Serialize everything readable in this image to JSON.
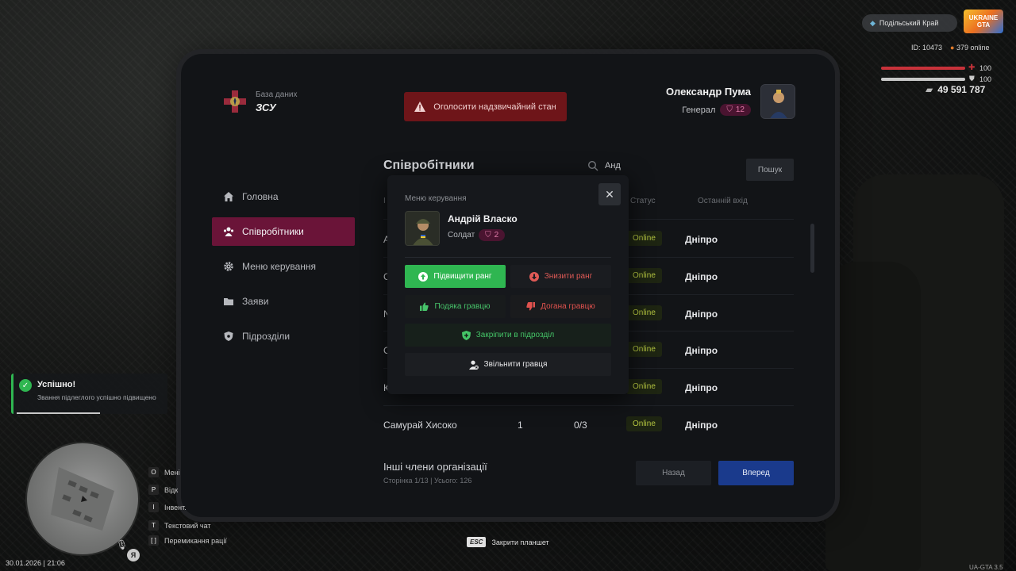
{
  "brand": {
    "subtitle": "База даних",
    "title": "ЗСУ"
  },
  "alert_button": {
    "label": "Оголосити надзвичайний стан"
  },
  "user": {
    "name": "Олександр Пума",
    "rank": "Генерал",
    "rank_level": "12"
  },
  "sidebar": {
    "items": [
      {
        "label": "Головна",
        "icon": "home-icon",
        "active": false
      },
      {
        "label": "Співробітники",
        "icon": "people-icon",
        "active": true
      },
      {
        "label": "Меню керування",
        "icon": "gear-icon",
        "active": false
      },
      {
        "label": "Заяви",
        "icon": "folder-icon",
        "active": false
      },
      {
        "label": "Підрозділи",
        "icon": "shield-icon",
        "active": false
      }
    ]
  },
  "main": {
    "title": "Співробітники",
    "search_value": "Анд",
    "search_button": "Пошук",
    "columns": {
      "id": "І",
      "status": "Статус",
      "last_login": "Останній вхід"
    },
    "rows": [
      {
        "name_initial": "А",
        "status": "Online",
        "city": "Дніпро"
      },
      {
        "name_initial": "С",
        "status": "Online",
        "city": "Дніпро"
      },
      {
        "name_initial": "N",
        "status": "Online",
        "city": "Дніпро"
      },
      {
        "name_initial": "С",
        "status": "Online",
        "city": "Дніпро"
      },
      {
        "name_initial": "К",
        "status": "Online",
        "city": "Дніпро"
      },
      {
        "name": "Самурай Хисоко",
        "rank": "1",
        "warnings": "0/3",
        "status": "Online",
        "city": "Дніпро"
      }
    ],
    "other_title": "Інші члени організації",
    "other_subtitle": "Сторінка 1/13 | Усього: 126",
    "back_button": "Назад",
    "next_button": "Вперед"
  },
  "modal": {
    "title": "Меню керування",
    "close": "✕",
    "person_name": "Андрій Власко",
    "person_rank": "Солдат",
    "person_rank_level": "2",
    "actions": {
      "promote": "Підвищити ранг",
      "demote": "Знизити ранг",
      "thanks": "Подяка гравцю",
      "reprimand": "Догана гравцю",
      "assign": "Закріпити в підрозділ",
      "fire": "Звільнити гравця"
    }
  },
  "hud": {
    "server": "Подільський Край",
    "logo_text": "UKRAINE GTA",
    "id": "ID: 10473",
    "online": "379 online",
    "health": "100",
    "armor": "100",
    "money": "49 591 787",
    "health_fraction": 1.0,
    "armor_fraction": 1.0
  },
  "toast": {
    "title": "Успішно!",
    "text": "Звання підлеглого успішно підвищено",
    "progress_fraction": 0.55
  },
  "keys": [
    {
      "key": "O",
      "label": "Мені"
    },
    {
      "key": "P",
      "label": "Відк"
    },
    {
      "key": "I",
      "label": "Інвент."
    },
    {
      "key": "T",
      "label": "Текстовий чат"
    },
    {
      "key": "[  ]",
      "label": "Перемикання рації"
    }
  ],
  "datetime": "30.01.2026 | 21:06",
  "esc_hint": {
    "key": "ESC",
    "label": "Закрити планшет"
  },
  "version": "UA-GTA 3.5",
  "colors": {
    "accent": "#6a1438",
    "alert": "#6e1519",
    "success": "#2fb651",
    "danger": "#e05a56",
    "primary": "#1a3a8c"
  }
}
